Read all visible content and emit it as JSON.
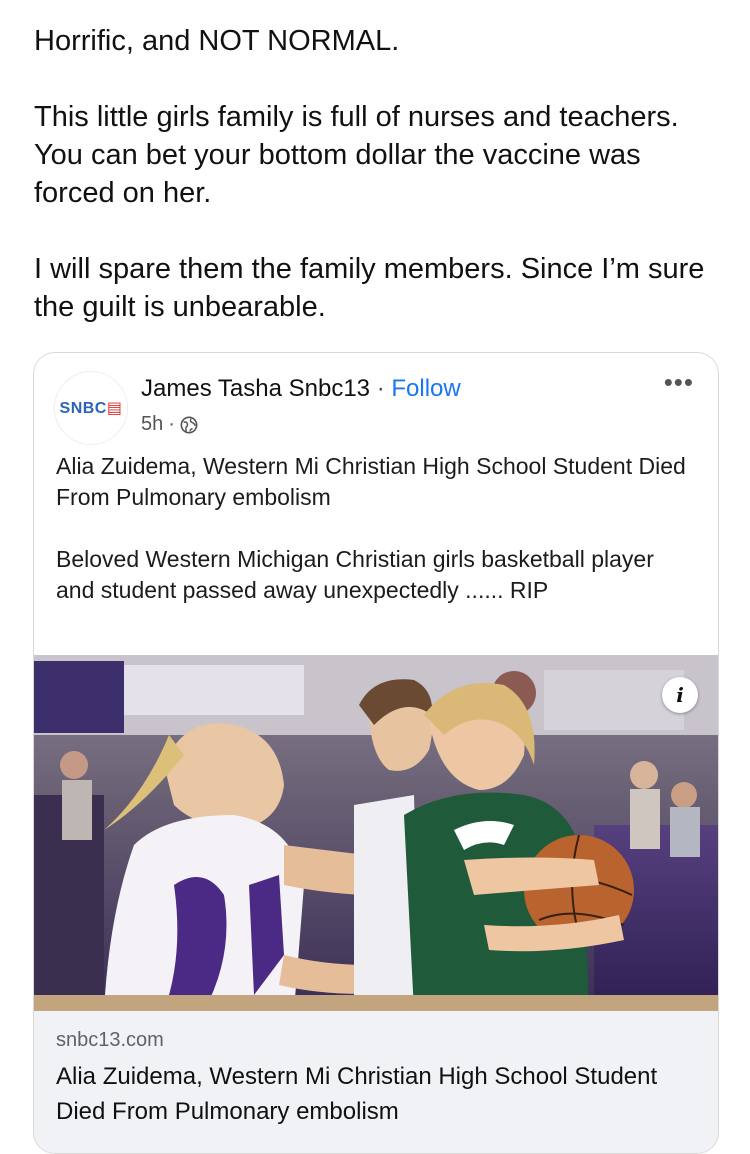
{
  "post": {
    "line1": "Horrific, and NOT NORMAL.",
    "line2": "This little girls family is full of nurses and teachers. You can bet your bottom dollar the vaccine was forced on her.",
    "line3": "I will spare them the family members. Since I’m sure the guilt is unbearable."
  },
  "shared": {
    "avatar_text_main": "SNBC",
    "avatar_text_accent": "▤",
    "author": "James Tasha Snbc13",
    "separator": "·",
    "follow_label": "Follow",
    "time": "5h",
    "time_separator": "·",
    "more_label": "•••",
    "headline": "Alia Zuidema, Western Mi Christian High School Student Died From Pulmonary embolism",
    "body": "Beloved Western Michigan Christian girls basketball player and student passed away unexpectedly ...... RIP",
    "info_label": "i",
    "image_icon": "globe-icon"
  },
  "link": {
    "domain": "snbc13.com",
    "title": "Alia Zuidema, Western Mi Christian High School Student Died From Pulmonary embolism"
  },
  "colors": {
    "accent": "#1877f2",
    "link_bg": "#f0f2f5",
    "jersey_purple": "#4b2a86",
    "jersey_green": "#1f5a3a"
  }
}
